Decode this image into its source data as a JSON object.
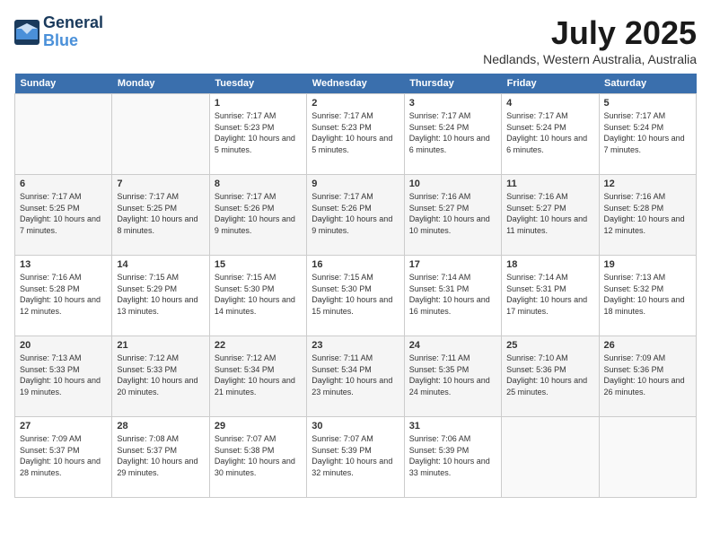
{
  "header": {
    "logo_line1": "General",
    "logo_line2": "Blue",
    "month_year": "July 2025",
    "location": "Nedlands, Western Australia, Australia"
  },
  "weekdays": [
    "Sunday",
    "Monday",
    "Tuesday",
    "Wednesday",
    "Thursday",
    "Friday",
    "Saturday"
  ],
  "weeks": [
    [
      {
        "day": "",
        "info": ""
      },
      {
        "day": "",
        "info": ""
      },
      {
        "day": "1",
        "info": "Sunrise: 7:17 AM\nSunset: 5:23 PM\nDaylight: 10 hours and 5 minutes."
      },
      {
        "day": "2",
        "info": "Sunrise: 7:17 AM\nSunset: 5:23 PM\nDaylight: 10 hours and 5 minutes."
      },
      {
        "day": "3",
        "info": "Sunrise: 7:17 AM\nSunset: 5:24 PM\nDaylight: 10 hours and 6 minutes."
      },
      {
        "day": "4",
        "info": "Sunrise: 7:17 AM\nSunset: 5:24 PM\nDaylight: 10 hours and 6 minutes."
      },
      {
        "day": "5",
        "info": "Sunrise: 7:17 AM\nSunset: 5:24 PM\nDaylight: 10 hours and 7 minutes."
      }
    ],
    [
      {
        "day": "6",
        "info": "Sunrise: 7:17 AM\nSunset: 5:25 PM\nDaylight: 10 hours and 7 minutes."
      },
      {
        "day": "7",
        "info": "Sunrise: 7:17 AM\nSunset: 5:25 PM\nDaylight: 10 hours and 8 minutes."
      },
      {
        "day": "8",
        "info": "Sunrise: 7:17 AM\nSunset: 5:26 PM\nDaylight: 10 hours and 9 minutes."
      },
      {
        "day": "9",
        "info": "Sunrise: 7:17 AM\nSunset: 5:26 PM\nDaylight: 10 hours and 9 minutes."
      },
      {
        "day": "10",
        "info": "Sunrise: 7:16 AM\nSunset: 5:27 PM\nDaylight: 10 hours and 10 minutes."
      },
      {
        "day": "11",
        "info": "Sunrise: 7:16 AM\nSunset: 5:27 PM\nDaylight: 10 hours and 11 minutes."
      },
      {
        "day": "12",
        "info": "Sunrise: 7:16 AM\nSunset: 5:28 PM\nDaylight: 10 hours and 12 minutes."
      }
    ],
    [
      {
        "day": "13",
        "info": "Sunrise: 7:16 AM\nSunset: 5:28 PM\nDaylight: 10 hours and 12 minutes."
      },
      {
        "day": "14",
        "info": "Sunrise: 7:15 AM\nSunset: 5:29 PM\nDaylight: 10 hours and 13 minutes."
      },
      {
        "day": "15",
        "info": "Sunrise: 7:15 AM\nSunset: 5:30 PM\nDaylight: 10 hours and 14 minutes."
      },
      {
        "day": "16",
        "info": "Sunrise: 7:15 AM\nSunset: 5:30 PM\nDaylight: 10 hours and 15 minutes."
      },
      {
        "day": "17",
        "info": "Sunrise: 7:14 AM\nSunset: 5:31 PM\nDaylight: 10 hours and 16 minutes."
      },
      {
        "day": "18",
        "info": "Sunrise: 7:14 AM\nSunset: 5:31 PM\nDaylight: 10 hours and 17 minutes."
      },
      {
        "day": "19",
        "info": "Sunrise: 7:13 AM\nSunset: 5:32 PM\nDaylight: 10 hours and 18 minutes."
      }
    ],
    [
      {
        "day": "20",
        "info": "Sunrise: 7:13 AM\nSunset: 5:33 PM\nDaylight: 10 hours and 19 minutes."
      },
      {
        "day": "21",
        "info": "Sunrise: 7:12 AM\nSunset: 5:33 PM\nDaylight: 10 hours and 20 minutes."
      },
      {
        "day": "22",
        "info": "Sunrise: 7:12 AM\nSunset: 5:34 PM\nDaylight: 10 hours and 21 minutes."
      },
      {
        "day": "23",
        "info": "Sunrise: 7:11 AM\nSunset: 5:34 PM\nDaylight: 10 hours and 23 minutes."
      },
      {
        "day": "24",
        "info": "Sunrise: 7:11 AM\nSunset: 5:35 PM\nDaylight: 10 hours and 24 minutes."
      },
      {
        "day": "25",
        "info": "Sunrise: 7:10 AM\nSunset: 5:36 PM\nDaylight: 10 hours and 25 minutes."
      },
      {
        "day": "26",
        "info": "Sunrise: 7:09 AM\nSunset: 5:36 PM\nDaylight: 10 hours and 26 minutes."
      }
    ],
    [
      {
        "day": "27",
        "info": "Sunrise: 7:09 AM\nSunset: 5:37 PM\nDaylight: 10 hours and 28 minutes."
      },
      {
        "day": "28",
        "info": "Sunrise: 7:08 AM\nSunset: 5:37 PM\nDaylight: 10 hours and 29 minutes."
      },
      {
        "day": "29",
        "info": "Sunrise: 7:07 AM\nSunset: 5:38 PM\nDaylight: 10 hours and 30 minutes."
      },
      {
        "day": "30",
        "info": "Sunrise: 7:07 AM\nSunset: 5:39 PM\nDaylight: 10 hours and 32 minutes."
      },
      {
        "day": "31",
        "info": "Sunrise: 7:06 AM\nSunset: 5:39 PM\nDaylight: 10 hours and 33 minutes."
      },
      {
        "day": "",
        "info": ""
      },
      {
        "day": "",
        "info": ""
      }
    ]
  ]
}
